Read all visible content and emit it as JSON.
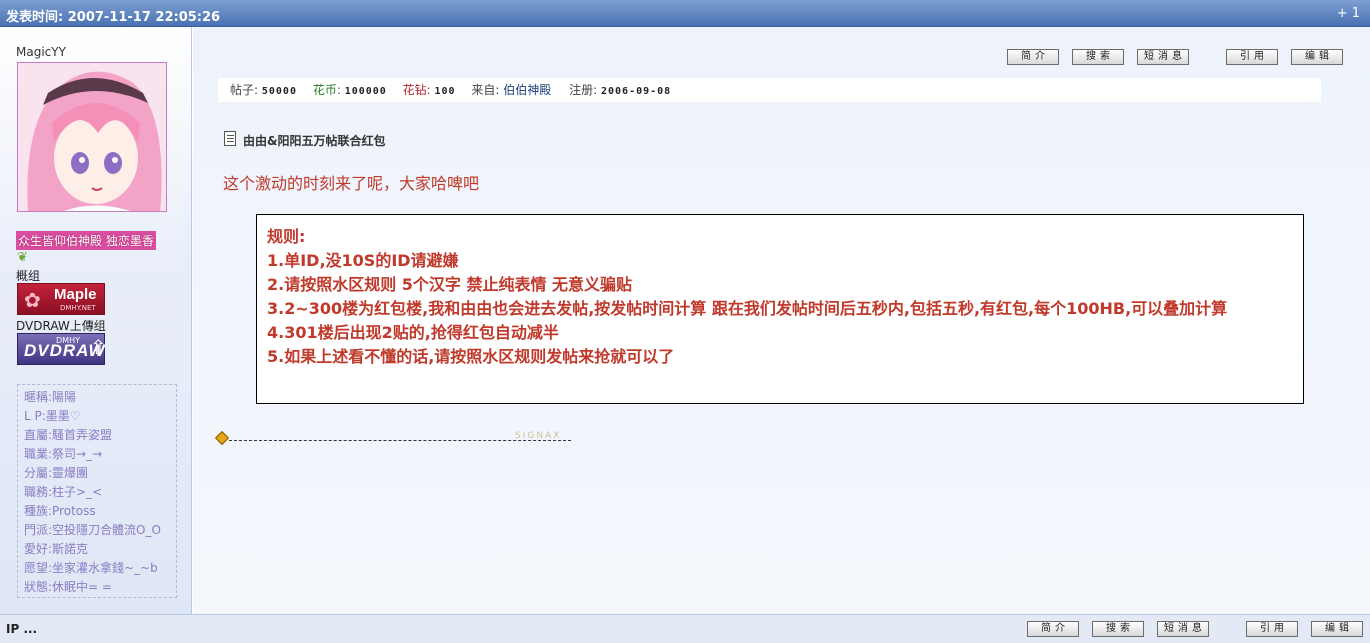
{
  "header": {
    "post_time": "发表时间: 2007-11-17 22:05:26",
    "floor": "+ 1"
  },
  "user": {
    "name": "MagicYY",
    "title_badge": "众生皆仰伯神殿 独恋墨香",
    "group_label": "概组",
    "maple_badge": {
      "text": "Maple",
      "sub": "DMHY.NET"
    },
    "dvd_label": "DVDRAW上傳组",
    "dvd_badge": {
      "text": "DVDRAW",
      "sub": "DMHY"
    },
    "profile": [
      "暱稱:陽陽",
      "L P:墨墨♡",
      "直屬:騷首弄姿盟",
      "職業:祭司→_→",
      "分屬:靈爆團",
      "職務:柱子>_<",
      "種族:Protoss",
      "門派:空投隱刀合體流O_O",
      "愛好:斯諾克",
      "愿望:坐家灌水拿錢~_~b",
      "狀態:休眠中= ="
    ]
  },
  "actions": {
    "profile": "简介",
    "search": "搜索",
    "message": "短消息",
    "quote": "引用",
    "edit": "编辑"
  },
  "stats": {
    "posts_label": "帖子:",
    "posts_value": "50000",
    "coins_label": "花币:",
    "coins_value": "100000",
    "diamonds_label": "花钻:",
    "diamonds_value": "100",
    "from_label": "来自:",
    "from_value": "伯伯神殿",
    "reg_label": "注册:",
    "reg_value": "2006-09-08"
  },
  "post": {
    "title": "由由&阳阳五万帖联合红包",
    "intro": "这个激动的时刻来了呢，大家哈啤吧",
    "rules": [
      "规则:",
      "1.单ID,没10S的ID请避嫌",
      "2.请按照水区规则 5个汉字 禁止纯表情 无意义骗贴",
      "3.2~300楼为红包楼,我和由由也会进去发帖,按发帖时间计算 跟在我们发帖时间后五秒内,包括五秒,有红包,每个100HB,可以叠加计算",
      "4.301楼后出现2贴的,抢得红包自动减半",
      "5.如果上述看不懂的话,请按照水区规则发帖来抢就可以了"
    ],
    "signature_text": "SIGNAX"
  },
  "footer": {
    "ip": "IP ..."
  }
}
